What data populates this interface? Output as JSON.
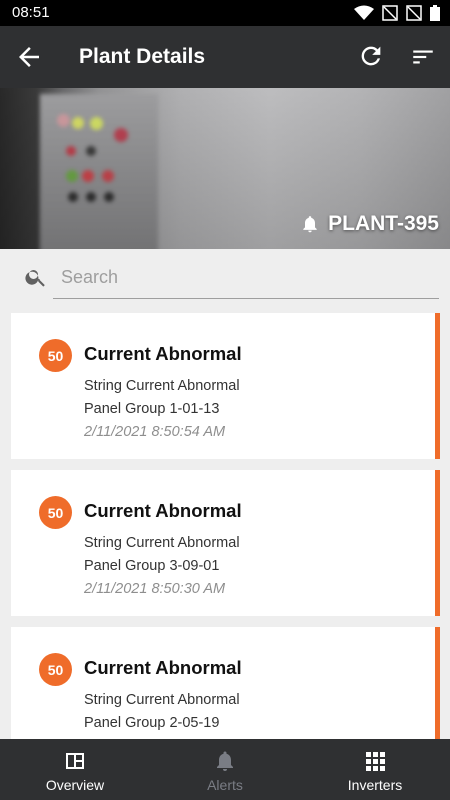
{
  "status_bar": {
    "time": "08:51"
  },
  "app_bar": {
    "title": "Plant Details"
  },
  "hero": {
    "plant_name": "PLANT-395"
  },
  "search": {
    "placeholder": "Search"
  },
  "alerts": [
    {
      "severity": "50",
      "title": "Current Abnormal",
      "type": "String Current Abnormal",
      "location": "Panel Group 1-01-13",
      "timestamp": "2/11/2021 8:50:54 AM"
    },
    {
      "severity": "50",
      "title": "Current Abnormal",
      "type": "String Current Abnormal",
      "location": "Panel Group 3-09-01",
      "timestamp": "2/11/2021 8:50:30 AM"
    },
    {
      "severity": "50",
      "title": "Current Abnormal",
      "type": "String Current Abnormal",
      "location": "Panel Group 2-05-19",
      "timestamp": ""
    }
  ],
  "bottom_nav": {
    "items": [
      {
        "label": "Overview",
        "icon": "overview-icon",
        "active": true
      },
      {
        "label": "Alerts",
        "icon": "bell-icon",
        "active": false
      },
      {
        "label": "Inverters",
        "icon": "grid-icon",
        "active": true
      }
    ]
  },
  "colors": {
    "accent": "#ef6c2a",
    "app_bar": "#2f3032",
    "background": "#eeeeee",
    "nav_inactive": "#7a7d85"
  }
}
